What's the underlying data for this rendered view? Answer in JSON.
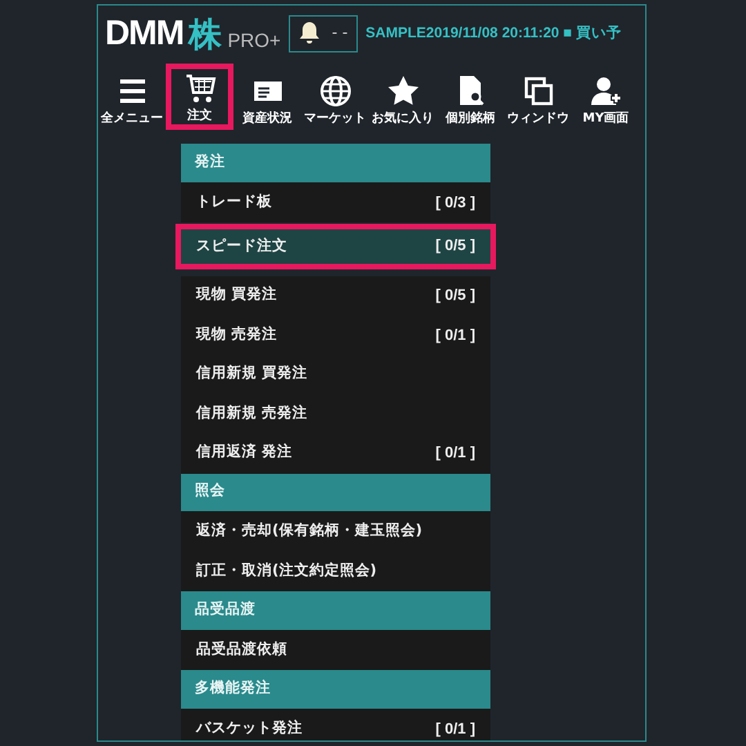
{
  "header": {
    "logo": "DMM",
    "logo_kanji": "株",
    "logo_suffix": "PRO+",
    "alert_count": "- -",
    "ticker": "SAMPLE2019/11/08 20:11:20 ■ 買い予"
  },
  "toolbar": [
    {
      "label": "全メニュー",
      "kind": "menu",
      "selected": false
    },
    {
      "label": "注文",
      "kind": "cart",
      "selected": true
    },
    {
      "label": "資産状況",
      "kind": "card",
      "selected": false
    },
    {
      "label": "マーケット",
      "kind": "globe",
      "selected": false
    },
    {
      "label": "お気に入り",
      "kind": "star",
      "selected": false
    },
    {
      "label": "個別銘柄",
      "kind": "doc",
      "selected": false
    },
    {
      "label": "ウィンドウ",
      "kind": "window",
      "selected": false
    },
    {
      "label": "MY画面",
      "kind": "user",
      "selected": false
    }
  ],
  "menu": [
    {
      "title": "発注",
      "items": [
        {
          "label": "トレード板",
          "count": "[ 0/3 ]",
          "selected": false
        },
        {
          "label": "スピード注文",
          "count": "[ 0/5 ]",
          "selected": true
        },
        {
          "label": "現物 買発注",
          "count": "[ 0/5 ]",
          "selected": false
        },
        {
          "label": "現物 売発注",
          "count": "[ 0/1 ]",
          "selected": false
        },
        {
          "label": "信用新規 買発注",
          "selected": false
        },
        {
          "label": "信用新規 売発注",
          "selected": false
        },
        {
          "label": "信用返済 発注",
          "count": "[ 0/1 ]",
          "selected": false
        }
      ]
    },
    {
      "title": "照会",
      "items": [
        {
          "label": "返済・売却(保有銘柄・建玉照会)",
          "selected": false
        },
        {
          "label": "訂正・取消(注文約定照会)",
          "selected": false
        }
      ]
    },
    {
      "title": "品受品渡",
      "items": [
        {
          "label": "品受品渡依頼",
          "selected": false
        }
      ]
    },
    {
      "title": "多機能発注",
      "items": [
        {
          "label": "バスケット発注",
          "count": "[ 0/1 ]",
          "selected": false
        }
      ]
    }
  ]
}
